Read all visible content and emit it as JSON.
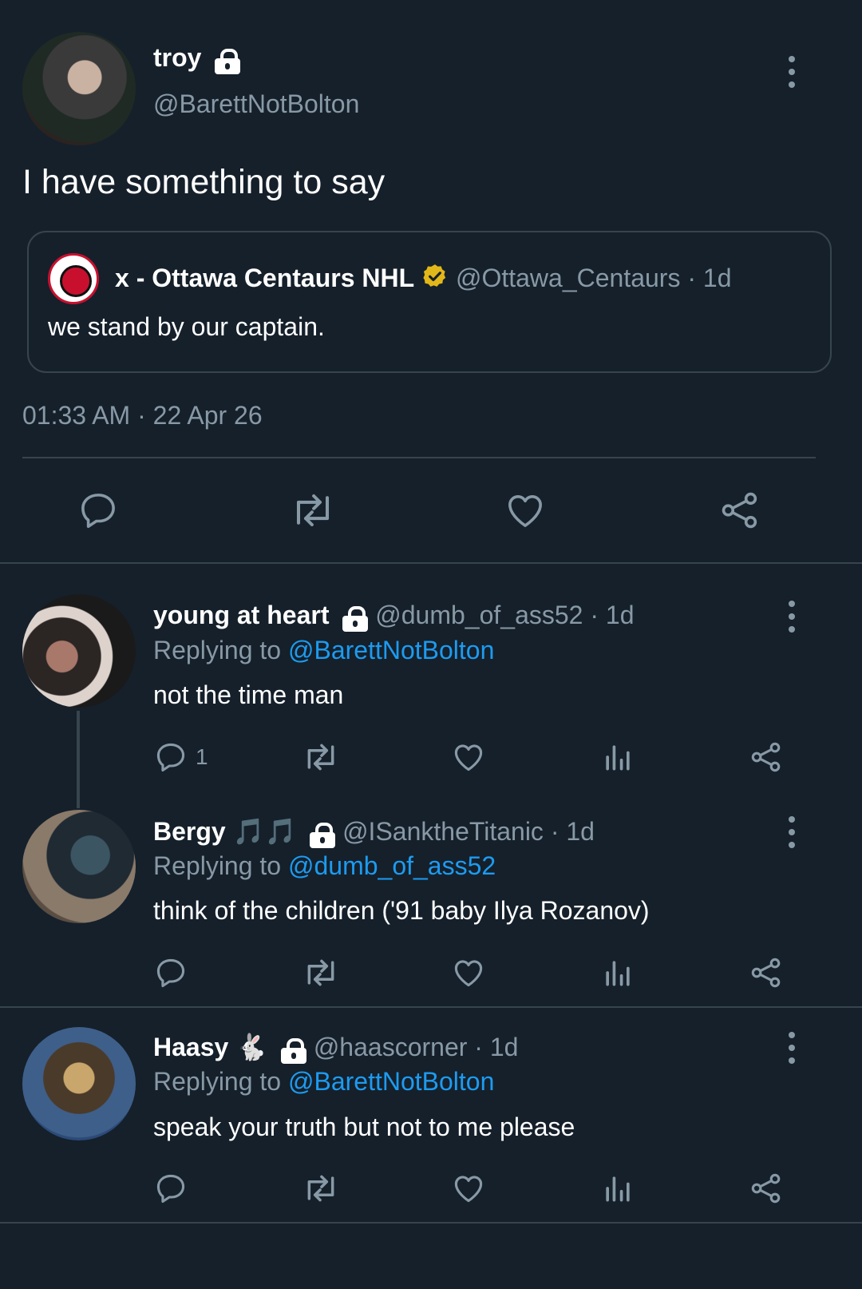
{
  "main_tweet": {
    "display_name": "troy",
    "handle": "@BarettNotBolton",
    "text": "I have something to say",
    "timestamp": "01:33 AM · 22 Apr 26"
  },
  "quoted_tweet": {
    "display_name": "x - Ottawa Centaurs NHL",
    "handle": "@Ottawa_Centaurs",
    "time": "· 1d",
    "text": "we stand by our captain."
  },
  "replies": [
    {
      "display_name": "young at heart",
      "handle": "@dumb_of_ass52",
      "time": "· 1d",
      "replying_label": "Replying to",
      "replying_to": "@BarettNotBolton",
      "text": "not the time man",
      "reply_count": "1"
    },
    {
      "display_name": "Bergy",
      "emoji": "🎵🎵",
      "handle": "@ISanktheTitanic",
      "time": "· 1d",
      "replying_label": "Replying to",
      "replying_to": "@dumb_of_ass52",
      "text": "think of the children ('91 baby Ilya Rozanov)"
    },
    {
      "display_name": "Haasy",
      "emoji": "🐇",
      "handle": "@haascorner",
      "time": "· 1d",
      "replying_label": "Replying to",
      "replying_to": "@BarettNotBolton",
      "text": "speak your truth but not to me please"
    }
  ],
  "colors": {
    "background": "#15202b",
    "muted": "#8899a6",
    "link": "#1d9bf0",
    "divider": "#38444d",
    "verified": "#e2b719"
  }
}
